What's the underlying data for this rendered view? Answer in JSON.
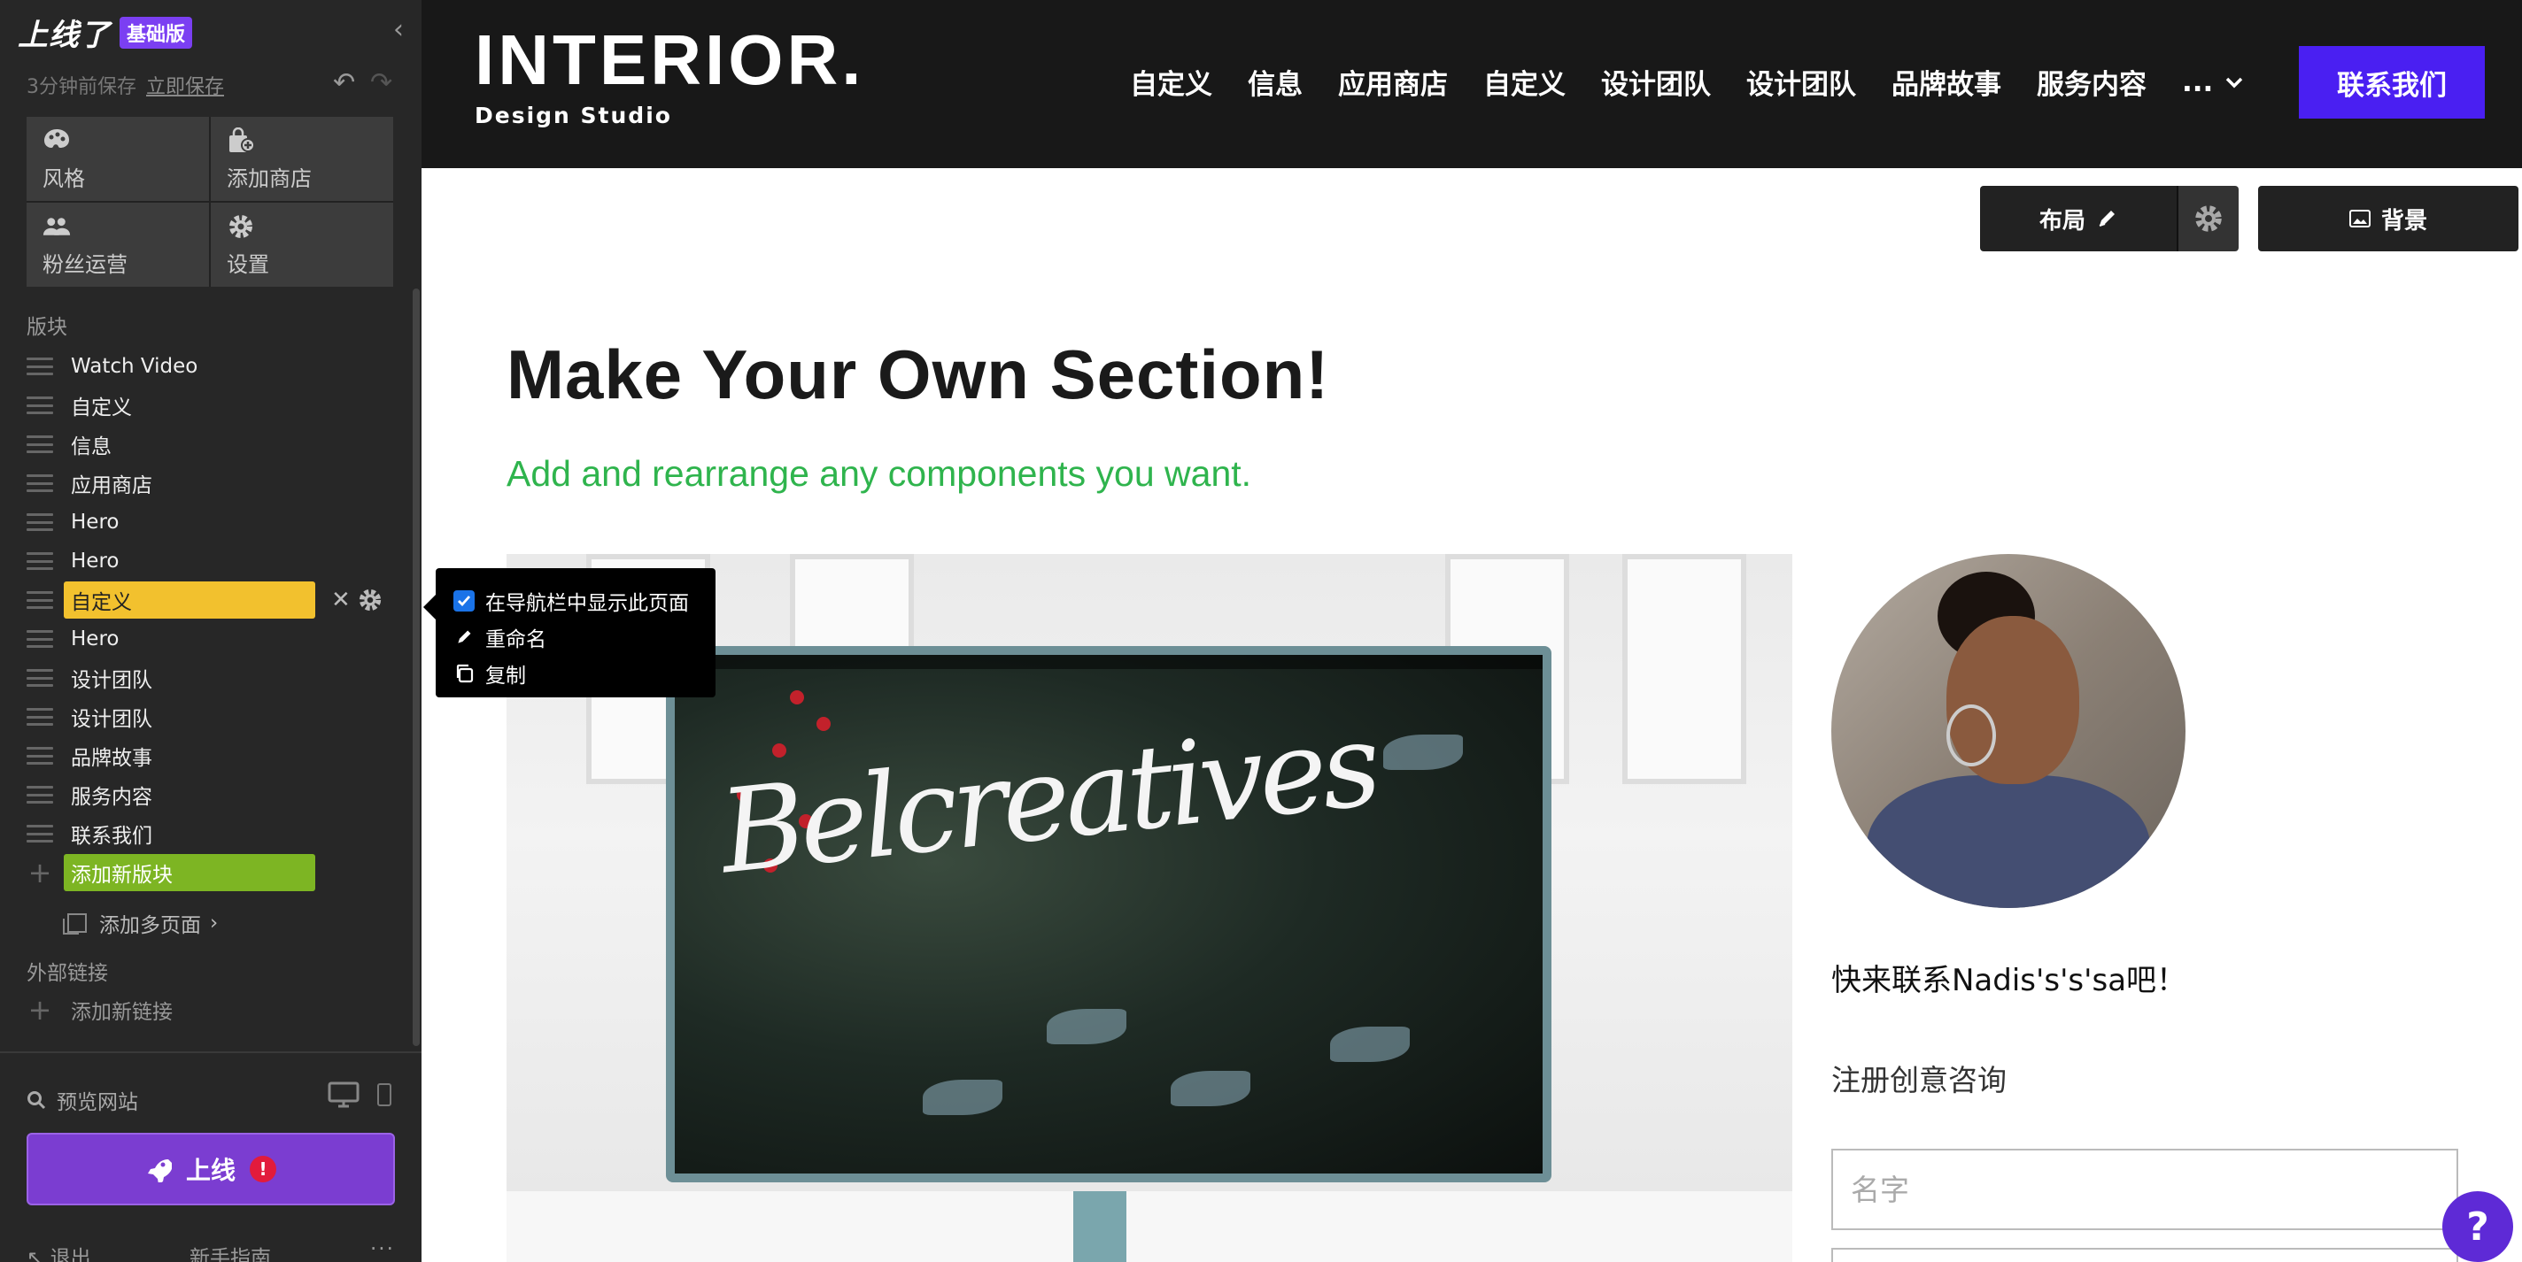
{
  "sidebar": {
    "brand": "上线了",
    "plan_badge": "基础版",
    "save_status": "3分钟前保存",
    "save_now": "立即保存",
    "tools": [
      {
        "label": "风格",
        "icon": "palette-icon"
      },
      {
        "label": "添加商店",
        "icon": "shop-icon"
      },
      {
        "label": "粉丝运营",
        "icon": "users-icon"
      },
      {
        "label": "设置",
        "icon": "gear-icon"
      }
    ],
    "blocks_heading": "版块",
    "blocks": [
      "Watch Video",
      "自定义",
      "信息",
      "应用商店",
      "Hero",
      "Hero",
      "自定义",
      "Hero",
      "设计团队",
      "设计团队",
      "品牌故事",
      "服务内容",
      "联系我们"
    ],
    "active_block_index": 6,
    "add_block": "添加新版块",
    "add_pages": "添加多页面",
    "external_heading": "外部链接",
    "add_link": "添加新链接",
    "preview": "预览网站",
    "launch": "上线",
    "launch_alert": "!",
    "exit": "退出",
    "guide": "新手指南",
    "more": "..."
  },
  "context_menu": {
    "show_in_nav": "在导航栏中显示此页面",
    "show_in_nav_checked": true,
    "rename": "重命名",
    "duplicate": "复制"
  },
  "topnav": {
    "logo_title": "INTERIOR.",
    "logo_sub": "Design Studio",
    "links": [
      "自定义",
      "信息",
      "应用商店",
      "自定义",
      "设计团队",
      "设计团队",
      "品牌故事",
      "服务内容"
    ],
    "more": "...",
    "contact": "联系我们"
  },
  "toolbar": {
    "layout": "布局",
    "background": "背景"
  },
  "section": {
    "title": "Make Your Own Section!",
    "subtitle": "Add and rearrange any components you want.",
    "photo_text": "Belcreatives",
    "contact_title": "快来联系Nadis's's'sa吧！",
    "signup_title": "注册创意咨询",
    "name_placeholder": "名字"
  },
  "help": "?",
  "colors": {
    "accent_purple": "#7b3dd1",
    "nav_button": "#4a1ff2",
    "active_block": "#f2c12e",
    "add_block": "#7db523",
    "subtitle_green": "#2fb44d"
  }
}
